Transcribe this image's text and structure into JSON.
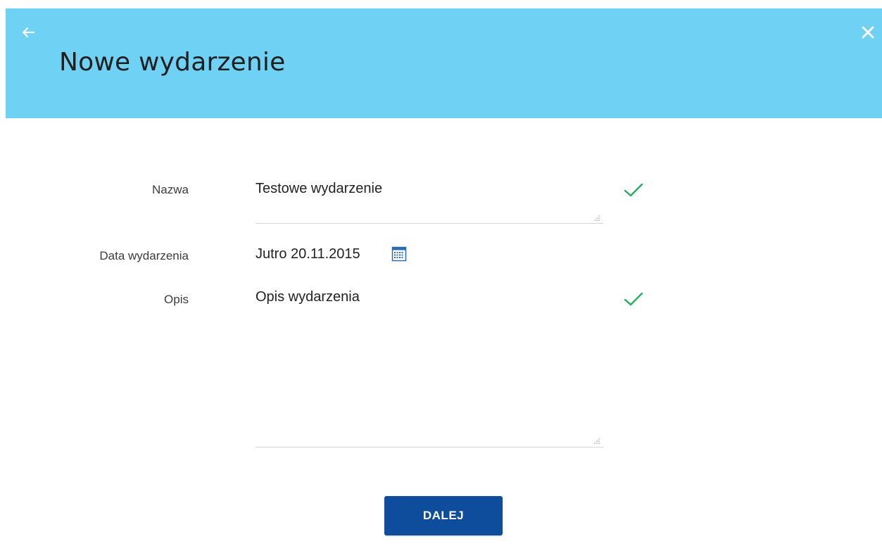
{
  "header": {
    "title": "Nowe wydarzenie",
    "back_icon": "arrow-left-icon",
    "close_icon": "close-icon",
    "background_color": "#6fd2f5"
  },
  "form": {
    "name": {
      "label": "Nazwa",
      "value": "Testowe wydarzenie",
      "valid": true
    },
    "date": {
      "label": "Data wydarzenia",
      "value": "Jutro 20.11.2015",
      "icon": "calendar-icon"
    },
    "description": {
      "label": "Opis",
      "value": "Opis wydarzenia",
      "valid": true
    }
  },
  "actions": {
    "next_label": "DALEJ",
    "button_color": "#0d4d9b"
  },
  "colors": {
    "valid_check": "#27ae60"
  }
}
